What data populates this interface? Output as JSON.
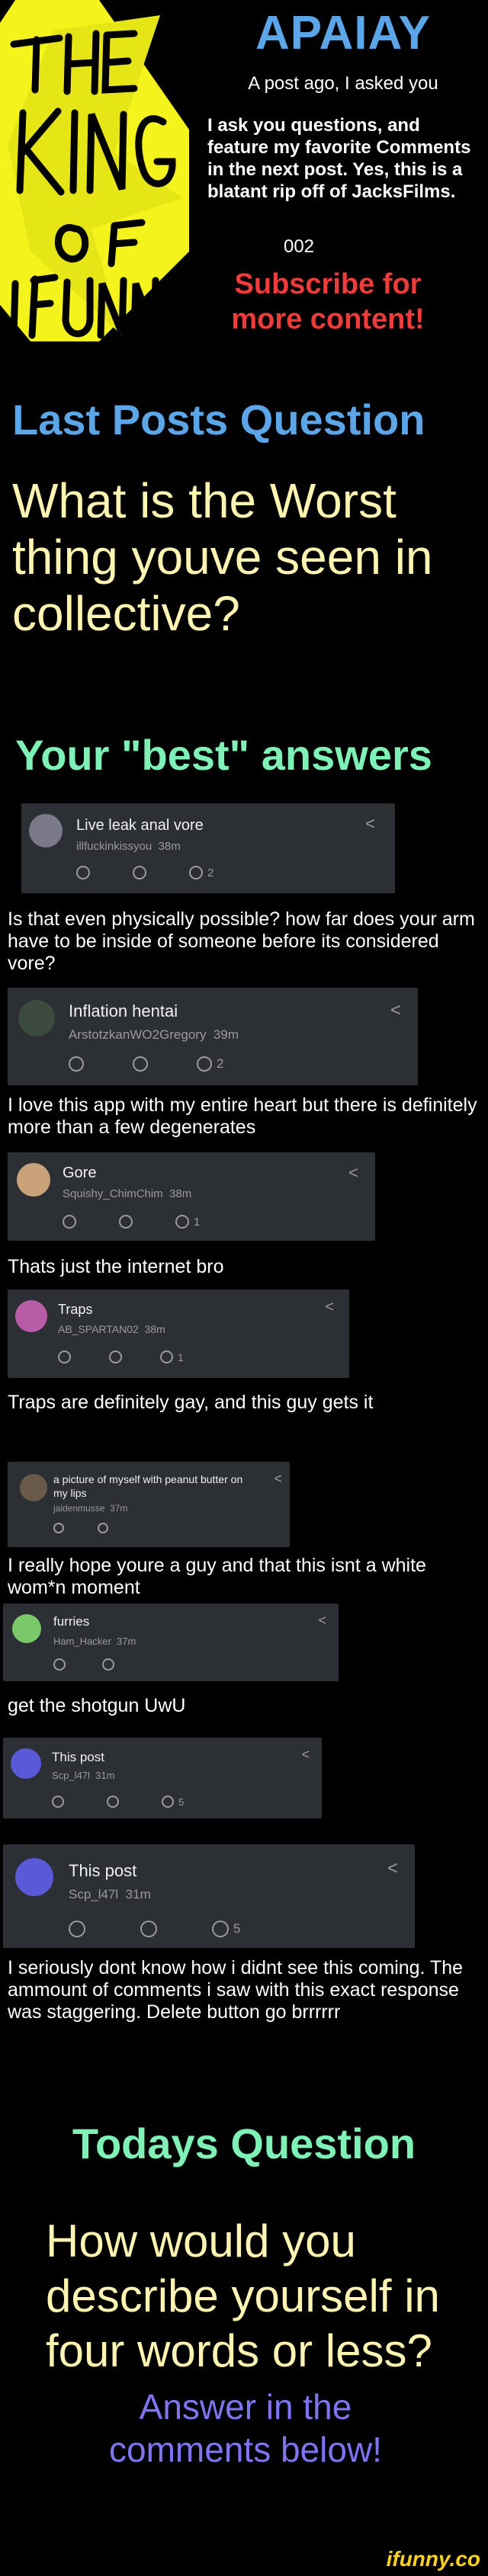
{
  "header": {
    "logo_text": "THE KING OF IFUNNY",
    "title": "APAIAY",
    "subtitle": "A post ago, I asked you",
    "description": "I ask you questions, and feature my favorite Comments in the next post. Yes, this is a blatant rip off of JacksFilms.",
    "number": "002",
    "subscribe": "Subscribe for more content!"
  },
  "last_posts": {
    "heading": "Last Posts Question",
    "question": "What is the Worst thing youve seen in collective?"
  },
  "answers": {
    "heading": "Your \"best\" answers",
    "items": [
      {
        "title": "Live leak anal vore",
        "user": "illfuckinkissyou",
        "time": "38m",
        "count": "2",
        "caption": "Is that even physically possible? how far does your arm have to be inside of someone before its considered vore?"
      },
      {
        "title": "Inflation hentai",
        "user": "ArstotzkanWO2Gregory",
        "time": "39m",
        "count": "2",
        "caption": "I love this app with my entire heart but there is definitely more than a few degenerates"
      },
      {
        "title": "Gore",
        "user": "Squishy_ChimChim",
        "time": "38m",
        "count": "1",
        "caption": "Thats just the internet bro"
      },
      {
        "title": "Traps",
        "user": "AB_SPARTAN02",
        "time": "38m",
        "count": "1",
        "caption": "Traps are definitely gay, and this guy gets it"
      },
      {
        "title": "a picture of myself with peanut butter on my lips",
        "user": "jaidenmusse",
        "time": "37m",
        "count": "",
        "caption": "I really hope youre a guy and that this isnt a white wom*n moment"
      },
      {
        "title": "furries",
        "user": "Ham_Hacker",
        "time": "37m",
        "count": "",
        "caption": "get the shotgun UwU"
      },
      {
        "title": "This post",
        "user": "Scp_l47l",
        "time": "31m",
        "count": "5",
        "caption": ""
      },
      {
        "title": "This post",
        "user": "Scp_l47l",
        "time": "31m",
        "count": "5",
        "caption": "I seriously dont know how i didnt see this coming. The ammount of comments i saw with this exact response was staggering. Delete button go brrrrrr"
      }
    ]
  },
  "today": {
    "heading": "Todays Question",
    "question": "How would you describe yourself in four words or less?",
    "cta": "Answer in the comments below!"
  },
  "watermark": "ifunny.co",
  "colors": {
    "blue": "#5aa6e8",
    "green": "#7ef2b6",
    "cream": "#fff4b0",
    "red": "#f03b3b",
    "purple": "#7f74f4",
    "card": "#2c2f33",
    "logo_yellow": "#f4f31b"
  }
}
